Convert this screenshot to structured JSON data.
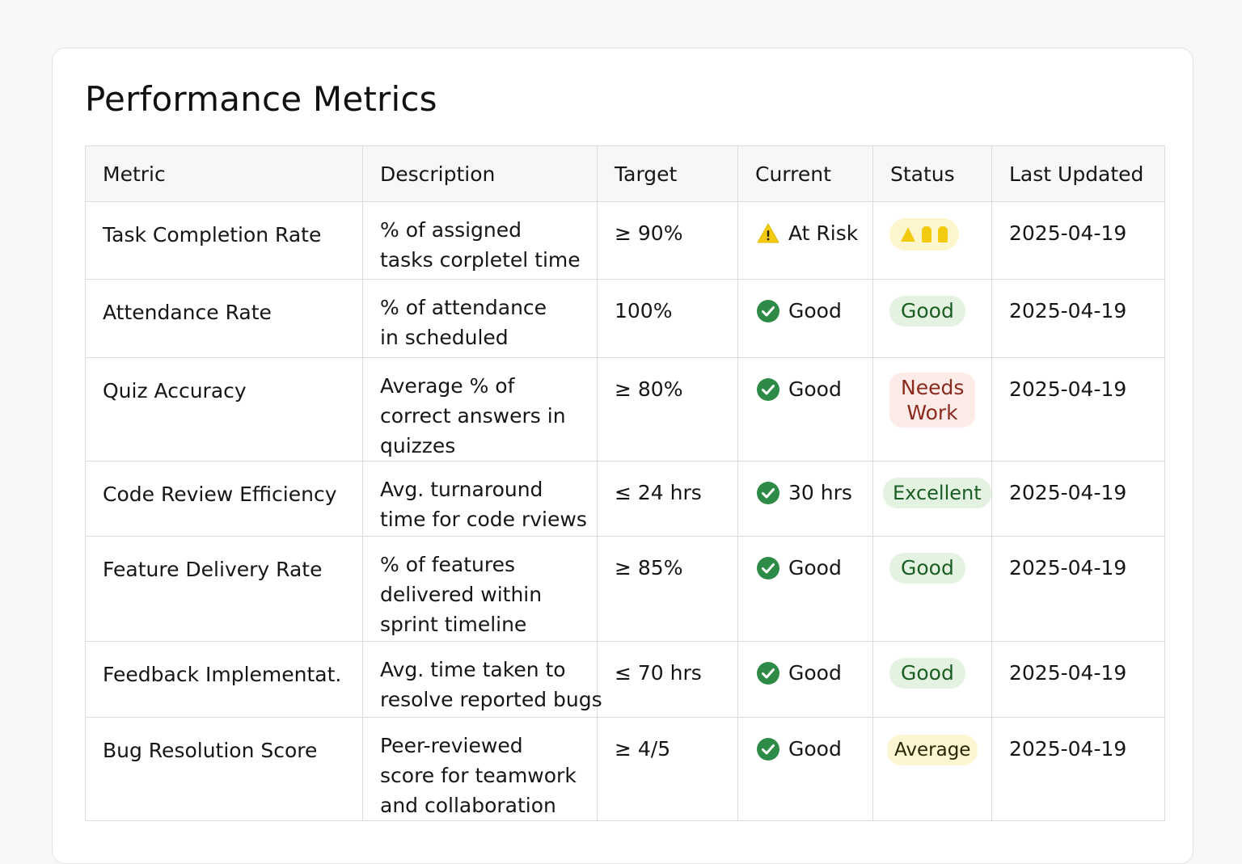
{
  "page": {
    "title": "Performance Metrics"
  },
  "table": {
    "headers": [
      "Metric",
      "Description",
      "Target",
      "Current",
      "Status",
      "Last Updated"
    ],
    "rows": [
      {
        "metric": "Task Completion Rate",
        "description": [
          "% of assigned",
          "tasks corpletel time"
        ],
        "target": "≥ 90%",
        "current": {
          "icon": "warning-icon",
          "text": "At Risk"
        },
        "status": {
          "type": "risk-icons",
          "label": ""
        },
        "updated": "2025-04-19"
      },
      {
        "metric": "Attendance Rate",
        "description": [
          "% of attendance",
          "in scheduled"
        ],
        "target": "100%",
        "current": {
          "icon": "check-circle-icon",
          "text": "Good"
        },
        "status": {
          "type": "good",
          "label": "Good"
        },
        "updated": "2025-04-19"
      },
      {
        "metric": "Quiz Accuracy",
        "description": [
          "Average % of",
          "correct answers in",
          "quizzes"
        ],
        "target": "≥ 80%",
        "current": {
          "icon": "check-circle-icon",
          "text": "Good"
        },
        "status": {
          "type": "needs",
          "label": "Needs Work"
        },
        "updated": "2025-04-19"
      },
      {
        "metric": "Code Review Efficiency",
        "description": [
          "Avg. turnaround",
          "time for code rviews"
        ],
        "target": "≤ 24 hrs",
        "current": {
          "icon": "check-circle-icon",
          "text": "30 hrs"
        },
        "status": {
          "type": "excellent",
          "label": "Excellent"
        },
        "updated": "2025-04-19"
      },
      {
        "metric": "Feature Delivery Rate",
        "description": [
          "% of features",
          "delivered within",
          "sprint timeline"
        ],
        "target": "≥ 85%",
        "current": {
          "icon": "check-circle-icon",
          "text": "Good"
        },
        "status": {
          "type": "good",
          "label": "Good"
        },
        "updated": "2025-04-19"
      },
      {
        "metric": "Feedback Implementat.",
        "description": [
          "Avg. time taken to",
          "resolve reported bugs"
        ],
        "target": "≤ 70 hrs",
        "current": {
          "icon": "check-circle-icon",
          "text": "Good"
        },
        "status": {
          "type": "good",
          "label": "Good"
        },
        "updated": "2025-04-19"
      },
      {
        "metric": "Bug Resolution Score",
        "description": [
          "Peer-reviewed",
          "score for teamwork",
          "and collaboration"
        ],
        "target": "≥ 4/5",
        "current": {
          "icon": "check-circle-icon",
          "text": "Good"
        },
        "status": {
          "type": "average",
          "label": "Average"
        },
        "updated": "2025-04-19"
      }
    ]
  },
  "colors": {
    "good_green": "#2e8b47",
    "warning_yellow": "#f2cb10",
    "badge_good_bg": "#e4f3e1",
    "badge_needs_bg": "#fcebe6",
    "badge_average_bg": "#fdf6d2"
  }
}
